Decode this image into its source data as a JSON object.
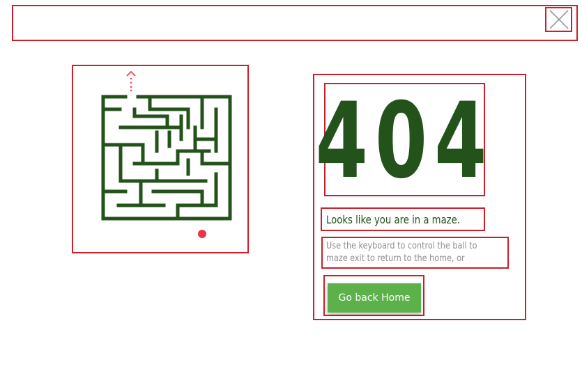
{
  "error": {
    "code": "404",
    "heading": "Looks like you are in a maze.",
    "description_line1": "Use the keyboard to control the ball to",
    "description_line2": "maze exit to return to the home, or",
    "home_button_label": "Go back Home"
  },
  "colors": {
    "maze_wall": "#23521a",
    "ball": "#ee3344",
    "exit_marker": "#ee5566",
    "button": "#5cb14b",
    "highlight_border": "#cc1f2a"
  },
  "icons": {
    "close": "close-icon",
    "exit": "exit-arrow-icon",
    "ball": "ball-icon"
  }
}
